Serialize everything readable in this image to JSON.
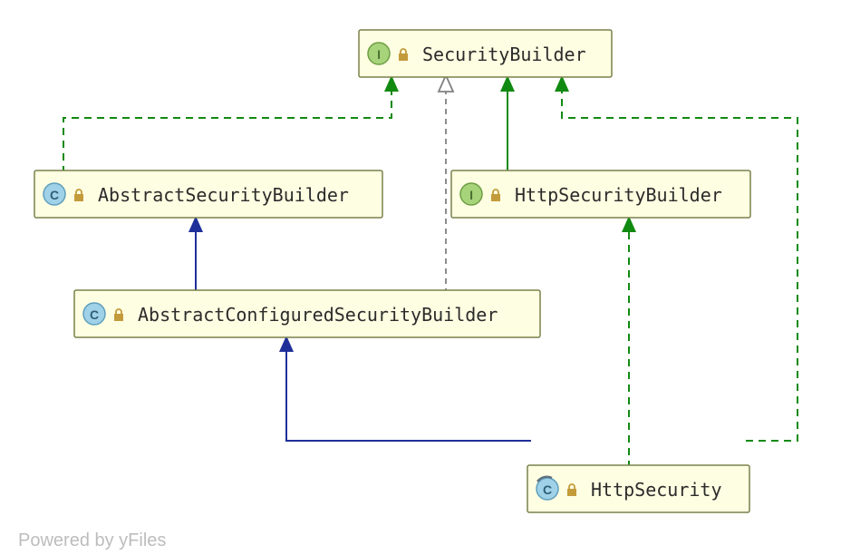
{
  "nodes": {
    "security_builder": {
      "label": "SecurityBuilder",
      "kind": "interface"
    },
    "abstract_security_builder": {
      "label": "AbstractSecurityBuilder",
      "kind": "class"
    },
    "http_security_builder": {
      "label": "HttpSecurityBuilder",
      "kind": "interface"
    },
    "abstract_configured_security_builder": {
      "label": "AbstractConfiguredSecurityBuilder",
      "kind": "class"
    },
    "http_security": {
      "label": "HttpSecurity",
      "kind": "class",
      "final": true
    }
  },
  "attribution": "Powered by yFiles",
  "colors": {
    "node_fill": "#fefee2",
    "node_stroke": "#7a804a",
    "extends": "#1f2f9a",
    "implements": "#118a11",
    "typeparam": "#808080"
  }
}
